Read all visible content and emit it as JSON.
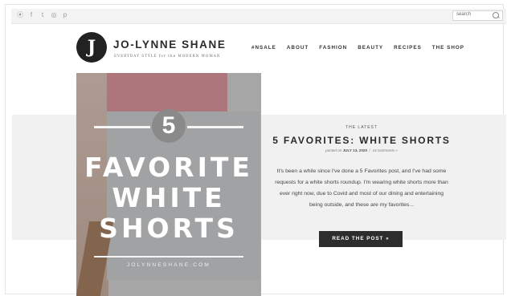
{
  "topbar": {
    "social_icons": [
      "rss-icon",
      "facebook-icon",
      "twitter-icon",
      "instagram-icon",
      "pinterest-icon"
    ],
    "social_glyphs": [
      "⦿",
      "f",
      "t",
      "◎",
      "p"
    ],
    "search_placeholder": "search"
  },
  "logo": {
    "mark": "J",
    "name": "JO-LYNNE SHANE",
    "tagline": "EVERYDAY STYLE for the MODERN WOMAN"
  },
  "nav": {
    "items": [
      "#NSALE",
      "ABOUT",
      "FASHION",
      "BEAUTY",
      "RECIPES",
      "THE SHOP"
    ]
  },
  "hero": {
    "number": "5",
    "line1": "FAVORITE",
    "line2": "WHITE",
    "line3": "SHORTS",
    "site": "JOLYNNESHANE.COM"
  },
  "post": {
    "kicker": "THE LATEST",
    "title": "5 FAVORITES: WHITE SHORTS",
    "meta_prefix": "posted on",
    "meta_date": "JULY 13, 2020",
    "meta_sep": "/",
    "meta_comments": "14 comments »",
    "excerpt": "It's been a while since I've done a 5 Favorites post, and I've had some requests for a white shorts roundup. I'm wearing white shorts more than ever right now, due to Covid and most of our dining and entertaining being outside, and these are my favorites...",
    "button_label": "READ THE POST »"
  },
  "colors": {
    "accent_dark": "#2d2d2d",
    "band": "#f1f1f1"
  }
}
